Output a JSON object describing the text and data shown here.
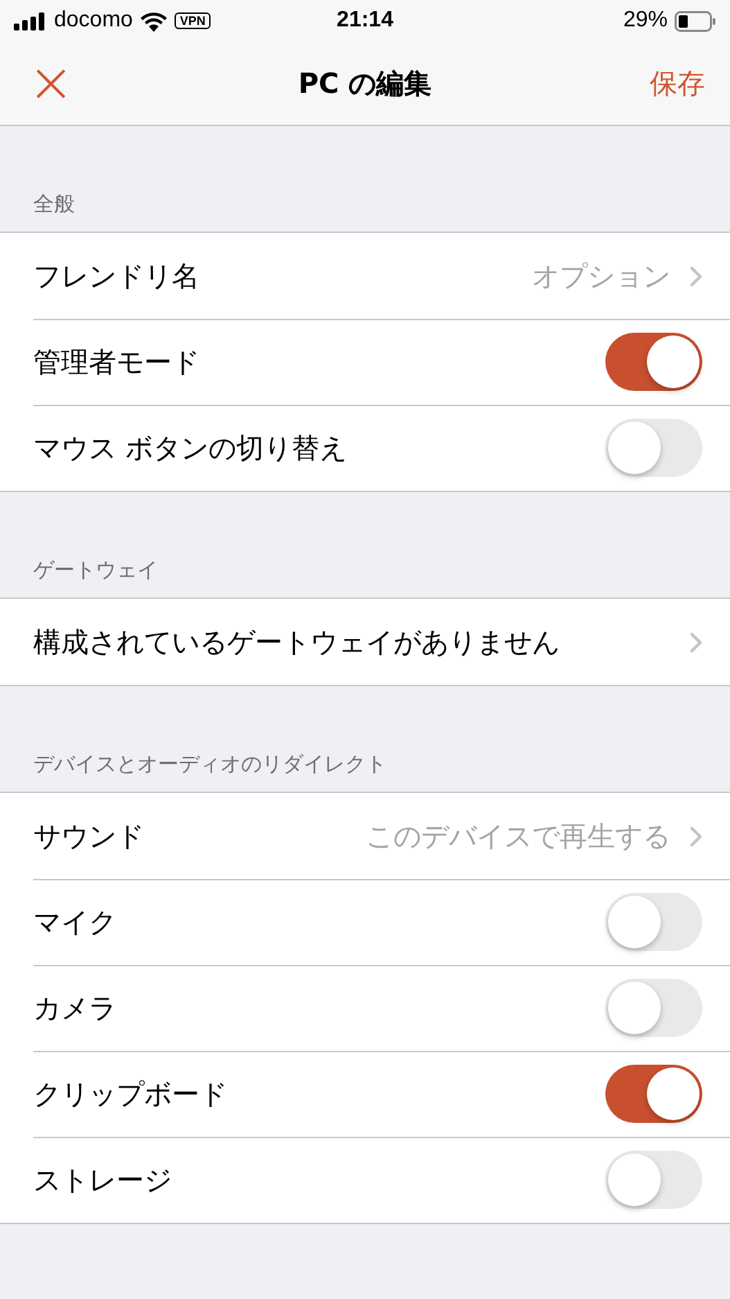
{
  "status_bar": {
    "carrier": "docomo",
    "vpn": "VPN",
    "time": "21:14",
    "battery": "29%"
  },
  "nav": {
    "close": "×",
    "title": "PC の編集",
    "save": "保存"
  },
  "sections": [
    {
      "header": "全般",
      "rows": [
        {
          "kind": "disclosure",
          "label": "フレンドリ名",
          "value": "オプション"
        },
        {
          "kind": "toggle",
          "label": "管理者モード",
          "on": true
        },
        {
          "kind": "toggle",
          "label": "マウス ボタンの切り替え",
          "on": false
        }
      ]
    },
    {
      "header": "ゲートウェイ",
      "rows": [
        {
          "kind": "disclosure",
          "label": "構成されているゲートウェイがありません"
        }
      ]
    },
    {
      "header": "デバイスとオーディオのリダイレクト",
      "rows": [
        {
          "kind": "disclosure",
          "label": "サウンド",
          "value": "このデバイスで再生する"
        },
        {
          "kind": "toggle",
          "label": "マイク",
          "on": false
        },
        {
          "kind": "toggle",
          "label": "カメラ",
          "on": false
        },
        {
          "kind": "toggle",
          "label": "クリップボード",
          "on": true
        },
        {
          "kind": "toggle",
          "label": "ストレージ",
          "on": false
        }
      ]
    }
  ]
}
